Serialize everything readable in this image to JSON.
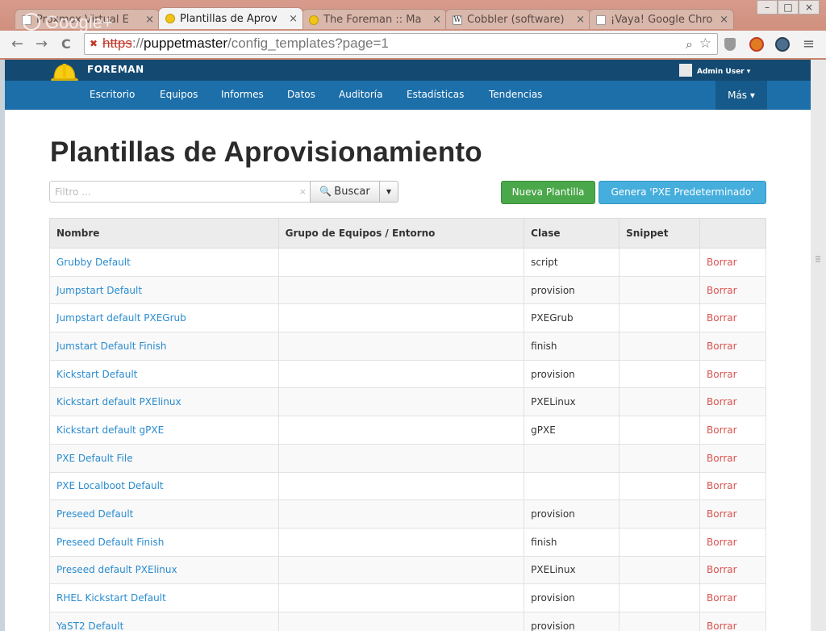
{
  "browser": {
    "tabs": [
      {
        "title": "Proxmox Virtual E",
        "icon": "doc-icon",
        "active": false
      },
      {
        "title": "Plantillas de Aprov",
        "icon": "foreman-icon",
        "active": true
      },
      {
        "title": "The Foreman :: Ma",
        "icon": "foreman-icon",
        "active": false
      },
      {
        "title": "Cobbler (software)",
        "icon": "wikipedia-icon",
        "active": false
      },
      {
        "title": "¡Vaya! Google Chro",
        "icon": "doc-icon",
        "active": false
      }
    ],
    "tab_close": "×",
    "window_buttons": [
      "–",
      "□",
      "×"
    ],
    "overlay_text": "Google+",
    "url": {
      "scheme": "https",
      "sep": "://",
      "host": "puppetmaster",
      "path": "/config_templates?page=1"
    },
    "nav_back": "←",
    "nav_forward": "→",
    "nav_reload": "C",
    "zoom_glyph": "⌕",
    "star_glyph": "☆",
    "menu_glyph": "≡"
  },
  "app": {
    "brand": "FOREMAN",
    "user": "Admin User ▾",
    "nav": [
      "Escritorio",
      "Equipos",
      "Informes",
      "Datos",
      "Auditoría",
      "Estadísticas",
      "Tendencias"
    ],
    "more": "Más ▾"
  },
  "main": {
    "title": "Plantillas de Aprovisionamiento",
    "filter_placeholder": "Filtro ...",
    "filter_clear": "×",
    "search_label": "Buscar",
    "search_icon": "🔍",
    "caret": "▼",
    "new_template": "Nueva Plantilla",
    "build_pxe": "Genera 'PXE Predeterminado'"
  },
  "table": {
    "headers": [
      "Nombre",
      "Grupo de Equipos / Entorno",
      "Clase",
      "Snippet",
      ""
    ],
    "rows": [
      {
        "name": "Grubby Default",
        "group": "",
        "kind": "script",
        "snippet": "",
        "action": "Borrar"
      },
      {
        "name": "Jumpstart Default",
        "group": "",
        "kind": "provision",
        "snippet": "",
        "action": "Borrar"
      },
      {
        "name": "Jumpstart default PXEGrub",
        "group": "",
        "kind": "PXEGrub",
        "snippet": "",
        "action": "Borrar"
      },
      {
        "name": "Jumstart Default Finish",
        "group": "",
        "kind": "finish",
        "snippet": "",
        "action": "Borrar"
      },
      {
        "name": "Kickstart Default",
        "group": "",
        "kind": "provision",
        "snippet": "",
        "action": "Borrar"
      },
      {
        "name": "Kickstart default PXElinux",
        "group": "",
        "kind": "PXELinux",
        "snippet": "",
        "action": "Borrar"
      },
      {
        "name": "Kickstart default gPXE",
        "group": "",
        "kind": "gPXE",
        "snippet": "",
        "action": "Borrar"
      },
      {
        "name": "PXE Default File",
        "group": "",
        "kind": "",
        "snippet": "",
        "action": "Borrar"
      },
      {
        "name": "PXE Localboot Default",
        "group": "",
        "kind": "",
        "snippet": "",
        "action": "Borrar"
      },
      {
        "name": "Preseed Default",
        "group": "",
        "kind": "provision",
        "snippet": "",
        "action": "Borrar"
      },
      {
        "name": "Preseed Default Finish",
        "group": "",
        "kind": "finish",
        "snippet": "",
        "action": "Borrar"
      },
      {
        "name": "Preseed default PXElinux",
        "group": "",
        "kind": "PXELinux",
        "snippet": "",
        "action": "Borrar"
      },
      {
        "name": "RHEL Kickstart Default",
        "group": "",
        "kind": "provision",
        "snippet": "",
        "action": "Borrar"
      },
      {
        "name": "YaST2 Default",
        "group": "",
        "kind": "provision",
        "snippet": "",
        "action": "Borrar"
      }
    ]
  },
  "colors": {
    "topbar": "#144a72",
    "nav": "#1d6fa9",
    "link": "#2a8ccf",
    "danger": "#d9534f",
    "success": "#4aa74a",
    "info": "#45aedc"
  }
}
